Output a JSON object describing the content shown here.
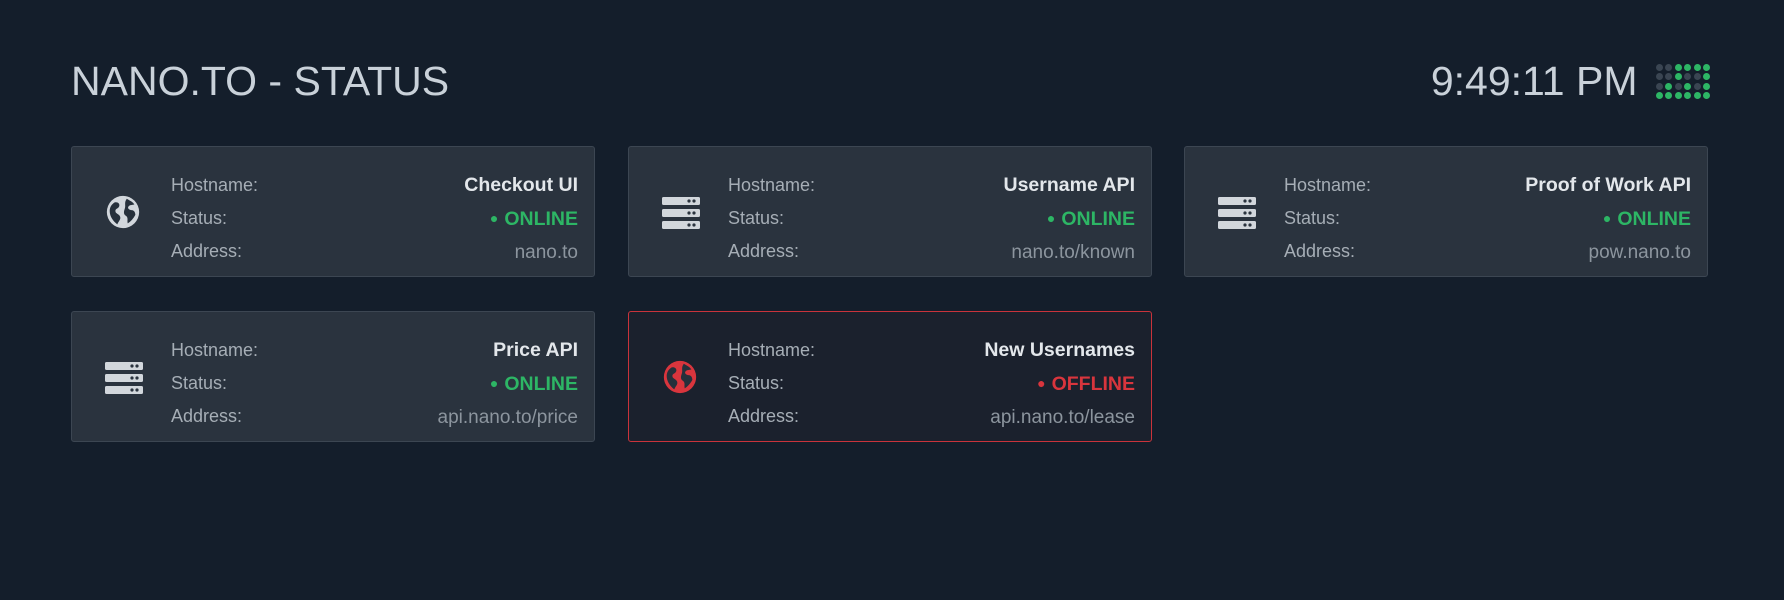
{
  "header": {
    "title": "NANO.TO - STATUS",
    "time": "9:49:11 PM"
  },
  "activity_dots": [
    [
      false,
      false,
      true,
      true,
      true,
      true
    ],
    [
      false,
      false,
      true,
      false,
      false,
      true
    ],
    [
      false,
      true,
      false,
      true,
      false,
      true
    ],
    [
      true,
      true,
      true,
      true,
      true,
      true
    ]
  ],
  "labels": {
    "hostname": "Hostname:",
    "status": "Status:",
    "address": "Address:"
  },
  "services": [
    {
      "hostname": "Checkout UI",
      "status": "ONLINE",
      "state": "online",
      "address": "nano.to",
      "icon": "globe-icon"
    },
    {
      "hostname": "Username API",
      "status": "ONLINE",
      "state": "online",
      "address": "nano.to/known",
      "icon": "server-icon"
    },
    {
      "hostname": "Proof of Work API",
      "status": "ONLINE",
      "state": "online",
      "address": "pow.nano.to",
      "icon": "server-icon"
    },
    {
      "hostname": "Price API",
      "status": "ONLINE",
      "state": "online",
      "address": "api.nano.to/price",
      "icon": "server-icon"
    },
    {
      "hostname": "New Usernames",
      "status": "OFFLINE",
      "state": "offline",
      "address": "api.nano.to/lease",
      "icon": "globe-icon"
    }
  ],
  "colors": {
    "background": "#141e2b",
    "card": "#2a333e",
    "online": "#2db665",
    "offline": "#d9353d",
    "icon": "#d2d7dc"
  },
  "bullet": "●"
}
